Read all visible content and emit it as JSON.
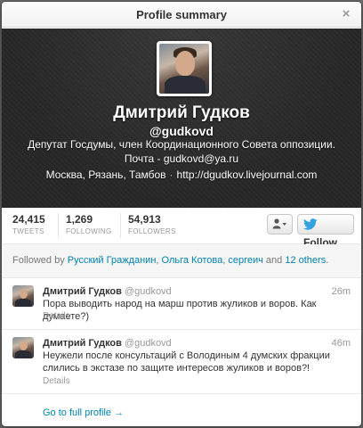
{
  "dialog": {
    "title": "Profile summary",
    "close_glyph": "×"
  },
  "profile": {
    "full_name": "Дмитрий Гудков",
    "screen_name": "@gudkovd",
    "bio": "Депутат Госдумы, член Координационного Совета оппозиции. Почта - gudkovd@ya.ru",
    "location": "Москва, Рязань, Тамбов",
    "separator": "·",
    "url": "http://dgudkov.livejournal.com"
  },
  "stats": {
    "tweets": {
      "count": "24,415",
      "label": "TWEETS"
    },
    "following": {
      "count": "1,269",
      "label": "FOLLOWING"
    },
    "followers": {
      "count": "54,913",
      "label": "FOLLOWERS"
    }
  },
  "actions": {
    "user_menu_icon": "user-dropdown-icon",
    "follow_label": "Follow"
  },
  "followed_by": {
    "prefix": "Followed by",
    "names": [
      "Русский Гражданин",
      "Ольга Котова",
      "сергеич"
    ],
    "sep1": ",",
    "sep2": ",",
    "and_text": "and",
    "others": "12 others",
    "suffix": "."
  },
  "tweets": [
    {
      "name": "Дмитрий Гудков",
      "handle": "@gudkovd",
      "time": "26m",
      "text": "Пора выводить народ на марш против жуликов и воров. Как думаете?)",
      "details": "Details"
    },
    {
      "name": "Дмитрий Гудков",
      "handle": "@gudkovd",
      "time": "46m",
      "text": "Неужели после консультаций с Володиным 4 думских фракции слились в экстазе по защите интересов жуликов и воров?!",
      "details": "Details"
    }
  ],
  "footer": {
    "go_full_profile": "Go to full profile →"
  },
  "colors": {
    "link": "#0084b4",
    "header_bg": "#292929",
    "follow_bird": "#33a3e0"
  }
}
